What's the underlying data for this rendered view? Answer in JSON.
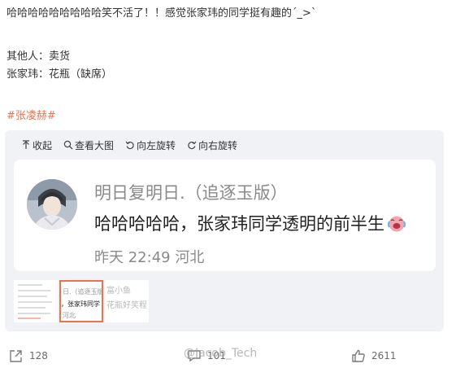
{
  "post": {
    "line1": "哈哈哈哈哈哈哈哈哈笑不活了！！感觉张家玮的同学挺有趣的´_>`",
    "line2": "其他人：卖货",
    "line3": "张家玮：花瓶（缺席）",
    "hashtag": "#张凌赫#"
  },
  "toolbar": {
    "collapse": "收起",
    "view_large": "查看大图",
    "rotate_left": "向左旋转",
    "rotate_right": "向右旋转"
  },
  "card": {
    "nickname": "明日复明日.（追逐玉版）",
    "content": "哈哈哈哈哈，张家玮同学透明的前半生",
    "emoji": "laughing-crying-face",
    "meta": "昨天 22:49  河北"
  },
  "thumbnails": [
    {
      "type": "document"
    },
    {
      "type": "card-crop",
      "line1": "日.（追逐玉版）",
      "line2": "，张家玮同学",
      "line3": "河北",
      "active": true
    },
    {
      "type": "faded",
      "line1": "富小鱼",
      "line2": "花瓶好笑程"
    }
  ],
  "actions": {
    "shares": "128",
    "comments": "101",
    "likes": "2611",
    "watermark": "@Jacob_Tech"
  },
  "colors": {
    "accent": "#eb7350",
    "panel_bg": "#f1f2f5",
    "muted_text": "#8a8a8a"
  }
}
